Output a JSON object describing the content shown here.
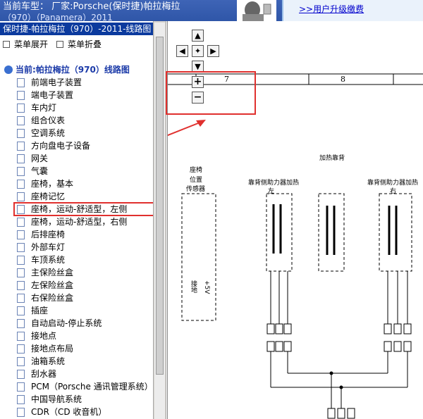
{
  "header": {
    "car_line1": "当前车型： 厂家:Porsche(保时捷)帕拉梅拉",
    "car_line2": "（970）（Panamera）2011",
    "upgrade_link": ">>用户升级缴费"
  },
  "tree": {
    "title": "保时捷-帕拉梅拉（970）-2011-线路图",
    "expand_label": "菜单展开",
    "collapse_label": "菜单折叠",
    "root_label": "当前:帕拉梅拉（970）线路图",
    "items": [
      "前端电子装置",
      "端电子装置",
      "车内灯",
      "组合仪表",
      "空调系统",
      "方向盘电子设备",
      "网关",
      "气囊",
      "座椅，基本",
      "座椅记忆",
      "座椅，运动-舒适型，左侧",
      "座椅，运动-舒适型，右侧",
      "后排座椅",
      "外部车灯",
      "车顶系统",
      "主保险丝盒",
      "左保险丝盒",
      "右保险丝盒",
      "插座",
      "自动启动-停止系统",
      "接地点",
      "接地点布局",
      "油箱系统",
      "刮水器",
      "PCM（Porsche 通讯管理系统）",
      "中国导航系统",
      "CDR（CD 收音机）"
    ],
    "selected_index": 10
  },
  "diagram": {
    "col_7": "7",
    "col_8": "8",
    "heated_back": "加热靠背",
    "seat_sensor_1": "座椅",
    "seat_sensor_2": "位置",
    "seat_sensor_3": "传感器",
    "left_heater_1": "靠背侧助力器加热",
    "left_heater_2": "左",
    "right_heater_1": "靠背侧助力器加热",
    "right_heater_2": "右",
    "ground_label": "接地",
    "plus5v_label": "+5V"
  },
  "colors": {
    "accent_red": "#e0302e",
    "tree_header": "#0b3a9e",
    "topbar": "#3e64b6"
  },
  "icons": [
    "arrow-up-icon",
    "arrow-left-icon",
    "pan-center-icon",
    "arrow-right-icon",
    "arrow-down-icon",
    "zoom-in-icon",
    "zoom-out-icon",
    "document-icon",
    "folder-root-icon"
  ]
}
